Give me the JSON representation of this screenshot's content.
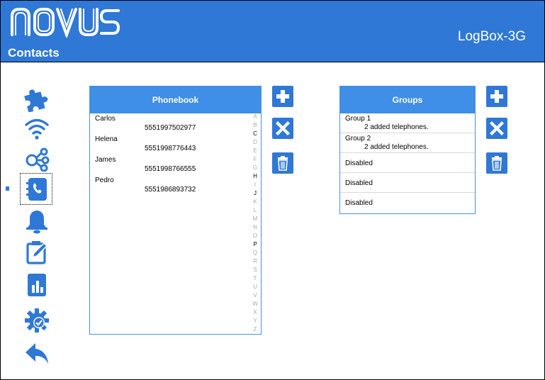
{
  "app": {
    "brand": "NOVUS",
    "section": "Contacts",
    "device": "LogBox-3G"
  },
  "sidebar": {
    "items": [
      {
        "icon": "puzzle-icon"
      },
      {
        "icon": "wifi-icon"
      },
      {
        "icon": "share-nodes-icon"
      },
      {
        "icon": "phonebook-icon",
        "active": true
      },
      {
        "icon": "bell-icon"
      },
      {
        "icon": "clipboard-edit-icon"
      },
      {
        "icon": "bar-chart-icon"
      },
      {
        "icon": "gear-check-icon"
      },
      {
        "icon": "back-arrow-icon"
      }
    ]
  },
  "phonebook": {
    "title": "Phonebook",
    "contacts": [
      {
        "name": "Carlos",
        "number": "5551997502977"
      },
      {
        "name": "Helena",
        "number": "5551998776443"
      },
      {
        "name": "James",
        "number": "5551998766555"
      },
      {
        "name": "Pedro",
        "number": "5551986893732"
      }
    ],
    "alphabet": [
      "A",
      "B",
      "C",
      "D",
      "E",
      "F",
      "G",
      "H",
      "I",
      "J",
      "K",
      "L",
      "M",
      "N",
      "O",
      "P",
      "Q",
      "R",
      "S",
      "T",
      "U",
      "V",
      "W",
      "X",
      "Y",
      "Z"
    ],
    "active_letters": [
      "C",
      "H",
      "J",
      "P"
    ]
  },
  "groups": {
    "title": "Groups",
    "items": [
      {
        "title": "Group 1",
        "subtitle": "2 added telephones."
      },
      {
        "title": "Group 2",
        "subtitle": "2 added telephones."
      },
      {
        "title": "Disabled",
        "subtitle": ""
      },
      {
        "title": "Disabled",
        "subtitle": ""
      },
      {
        "title": "Disabled",
        "subtitle": ""
      }
    ]
  },
  "colors": {
    "header": "#2f78d6",
    "panel_head": "#3f8ee8",
    "button": "#2f78d6"
  }
}
